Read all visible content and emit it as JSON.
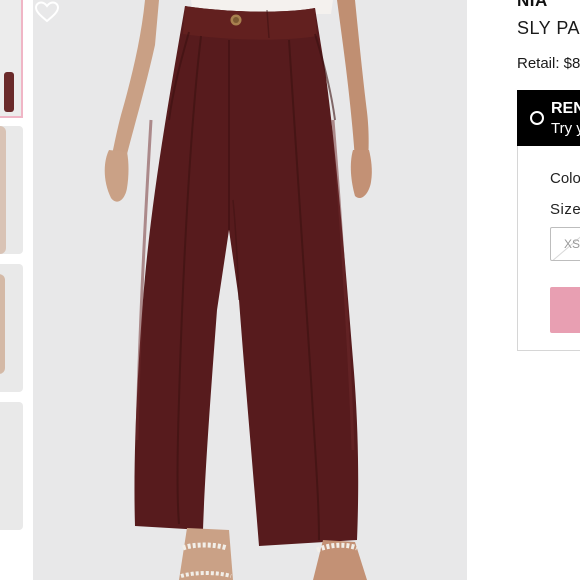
{
  "product": {
    "brand": "NIA",
    "name": "SLY PANT",
    "retail_label": "Retail: $8"
  },
  "rent_option": {
    "title": "RENT",
    "subtitle": "Try y"
  },
  "options": {
    "color_label": "Color",
    "size_label": "Size",
    "size_choice": "XS"
  },
  "icons": {
    "favorite": "heart-outline-icon",
    "rent_radio": "radio-unselected-icon"
  },
  "colors": {
    "pant": "#5a1c1e",
    "background_photo": "#e8e8e9",
    "rent_bg": "#000000",
    "cta": "#e89fb2",
    "thumb_active_border": "#f0b6c6"
  }
}
